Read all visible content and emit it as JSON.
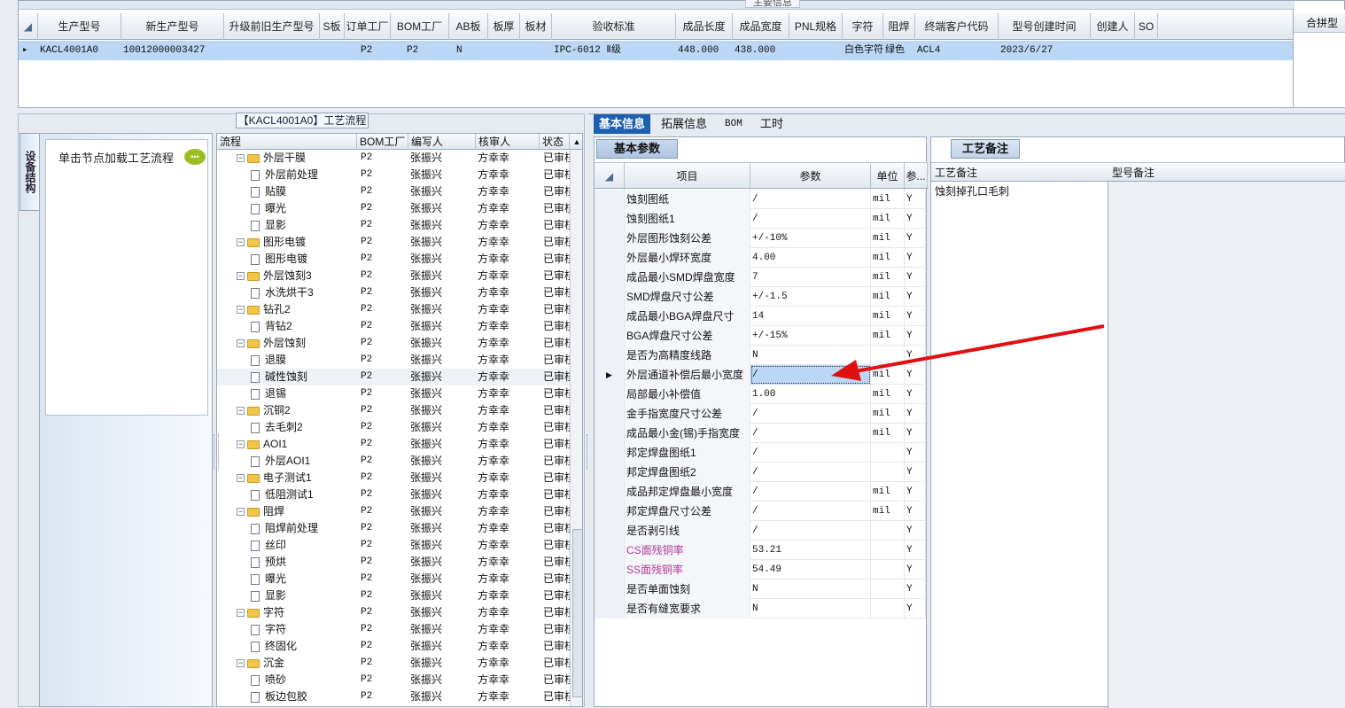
{
  "top": {
    "section_title": "主要信息",
    "columns": [
      "生产型号",
      "新生产型号",
      "升级前旧生产型号",
      "S板",
      "订单工厂",
      "BOM工厂",
      "AB板",
      "板厚",
      "板材",
      "验收标准",
      "成品长度",
      "成品宽度",
      "PNL规格",
      "字符",
      "阻焊",
      "终端客户代码",
      "型号创建时间",
      "创建人",
      "SO"
    ],
    "row": {
      "生产型号": "KACL4001A0",
      "新生产型号": "10012000003427",
      "订单工厂": "P2",
      "BOM工厂": "P2",
      "AB板": "N",
      "验收标准": "IPC-6012 Ⅱ级",
      "成品长度": "448.000",
      "成品宽度": "438.000",
      "字符": "白色字符",
      "阻焊": "绿色",
      "终端客户代码": "ACL4",
      "型号创建时间": "2023/6/27"
    },
    "side_column": "合拼型"
  },
  "left": {
    "process_title": "【KACL4001A0】工艺流程",
    "vertical_tab": "设备结构",
    "hint": "单击节点加载工艺流程"
  },
  "tree": {
    "headers": [
      "流程",
      "BOM工厂",
      "编写人",
      "核审人",
      "状态"
    ],
    "rows": [
      {
        "level": 0,
        "name": "外层干膜",
        "bom": "P2",
        "writer": "张振兴",
        "reviewer": "方幸幸",
        "status": "已审核"
      },
      {
        "level": 1,
        "name": "外层前处理",
        "bom": "P2",
        "writer": "张振兴",
        "reviewer": "方幸幸",
        "status": "已审核"
      },
      {
        "level": 1,
        "name": "贴膜",
        "bom": "P2",
        "writer": "张振兴",
        "reviewer": "方幸幸",
        "status": "已审核"
      },
      {
        "level": 1,
        "name": "曝光",
        "bom": "P2",
        "writer": "张振兴",
        "reviewer": "方幸幸",
        "status": "已审核"
      },
      {
        "level": 1,
        "name": "显影",
        "bom": "P2",
        "writer": "张振兴",
        "reviewer": "方幸幸",
        "status": "已审核"
      },
      {
        "level": 0,
        "name": "图形电镀",
        "bom": "P2",
        "writer": "张振兴",
        "reviewer": "方幸幸",
        "status": "已审核"
      },
      {
        "level": 1,
        "name": "图形电镀",
        "bom": "P2",
        "writer": "张振兴",
        "reviewer": "方幸幸",
        "status": "已审核"
      },
      {
        "level": 0,
        "name": "外层蚀刻3",
        "bom": "P2",
        "writer": "张振兴",
        "reviewer": "方幸幸",
        "status": "已审核"
      },
      {
        "level": 1,
        "name": "水洗烘干3",
        "bom": "P2",
        "writer": "张振兴",
        "reviewer": "方幸幸",
        "status": "已审核"
      },
      {
        "level": 0,
        "name": "钻孔2",
        "bom": "P2",
        "writer": "张振兴",
        "reviewer": "方幸幸",
        "status": "已审核"
      },
      {
        "level": 1,
        "name": "背钻2",
        "bom": "P2",
        "writer": "张振兴",
        "reviewer": "方幸幸",
        "status": "已审核"
      },
      {
        "level": 0,
        "name": "外层蚀刻",
        "bom": "P2",
        "writer": "张振兴",
        "reviewer": "方幸幸",
        "status": "已审核"
      },
      {
        "level": 1,
        "name": "退膜",
        "bom": "P2",
        "writer": "张振兴",
        "reviewer": "方幸幸",
        "status": "已审核"
      },
      {
        "level": 1,
        "name": "碱性蚀刻",
        "bom": "P2",
        "writer": "张振兴",
        "reviewer": "方幸幸",
        "status": "已审核",
        "selected": true
      },
      {
        "level": 1,
        "name": "退锡",
        "bom": "P2",
        "writer": "张振兴",
        "reviewer": "方幸幸",
        "status": "已审核"
      },
      {
        "level": 0,
        "name": "沉铜2",
        "bom": "P2",
        "writer": "张振兴",
        "reviewer": "方幸幸",
        "status": "已审核"
      },
      {
        "level": 1,
        "name": "去毛刺2",
        "bom": "P2",
        "writer": "张振兴",
        "reviewer": "方幸幸",
        "status": "已审核"
      },
      {
        "level": 0,
        "name": "AOI1",
        "bom": "P2",
        "writer": "张振兴",
        "reviewer": "方幸幸",
        "status": "已审核"
      },
      {
        "level": 1,
        "name": "外层AOI1",
        "bom": "P2",
        "writer": "张振兴",
        "reviewer": "方幸幸",
        "status": "已审核"
      },
      {
        "level": 0,
        "name": "电子测试1",
        "bom": "P2",
        "writer": "张振兴",
        "reviewer": "方幸幸",
        "status": "已审核"
      },
      {
        "level": 1,
        "name": "低阻测试1",
        "bom": "P2",
        "writer": "张振兴",
        "reviewer": "方幸幸",
        "status": "已审核"
      },
      {
        "level": 0,
        "name": "阻焊",
        "bom": "P2",
        "writer": "张振兴",
        "reviewer": "方幸幸",
        "status": "已审核"
      },
      {
        "level": 1,
        "name": "阻焊前处理",
        "bom": "P2",
        "writer": "张振兴",
        "reviewer": "方幸幸",
        "status": "已审核"
      },
      {
        "level": 1,
        "name": "丝印",
        "bom": "P2",
        "writer": "张振兴",
        "reviewer": "方幸幸",
        "status": "已审核"
      },
      {
        "level": 1,
        "name": "预烘",
        "bom": "P2",
        "writer": "张振兴",
        "reviewer": "方幸幸",
        "status": "已审核"
      },
      {
        "level": 1,
        "name": "曝光",
        "bom": "P2",
        "writer": "张振兴",
        "reviewer": "方幸幸",
        "status": "已审核"
      },
      {
        "level": 1,
        "name": "显影",
        "bom": "P2",
        "writer": "张振兴",
        "reviewer": "方幸幸",
        "status": "已审核"
      },
      {
        "level": 0,
        "name": "字符",
        "bom": "P2",
        "writer": "张振兴",
        "reviewer": "方幸幸",
        "status": "已审核"
      },
      {
        "level": 1,
        "name": "字符",
        "bom": "P2",
        "writer": "张振兴",
        "reviewer": "方幸幸",
        "status": "已审核"
      },
      {
        "level": 1,
        "name": "终固化",
        "bom": "P2",
        "writer": "张振兴",
        "reviewer": "方幸幸",
        "status": "已审核"
      },
      {
        "level": 0,
        "name": "沉金",
        "bom": "P2",
        "writer": "张振兴",
        "reviewer": "方幸幸",
        "status": "已审核"
      },
      {
        "level": 1,
        "name": "喷砂",
        "bom": "P2",
        "writer": "张振兴",
        "reviewer": "方幸幸",
        "status": "已审核"
      },
      {
        "level": 1,
        "name": "板边包胶",
        "bom": "P2",
        "writer": "张振兴",
        "reviewer": "方幸幸",
        "status": "已审核"
      }
    ]
  },
  "right_tabs": [
    "基本信息",
    "拓展信息",
    "BOM",
    "工时"
  ],
  "basic": {
    "tab": "基本参数",
    "headers": [
      "项目",
      "参数",
      "单位",
      "参..."
    ],
    "rows": [
      {
        "name": "蚀刻图纸",
        "value": "/",
        "unit": "mil",
        "flag": "Y"
      },
      {
        "name": "蚀刻图纸1",
        "value": "/",
        "unit": "mil",
        "flag": "Y"
      },
      {
        "name": "外层图形蚀刻公差",
        "value": "+/-10%",
        "unit": "mil",
        "flag": "Y"
      },
      {
        "name": "外层最小焊环宽度",
        "value": "4.00",
        "unit": "mil",
        "flag": "Y"
      },
      {
        "name": "成品最小SMD焊盘宽度",
        "value": "7",
        "unit": "mil",
        "flag": "Y"
      },
      {
        "name": "SMD焊盘尺寸公差",
        "value": "+/-1.5",
        "unit": "mil",
        "flag": "Y"
      },
      {
        "name": "成品最小BGA焊盘尺寸",
        "value": "14",
        "unit": "mil",
        "flag": "Y"
      },
      {
        "name": "BGA焊盘尺寸公差",
        "value": "+/-15%",
        "unit": "mil",
        "flag": "Y"
      },
      {
        "name": "是否为高精度线路",
        "value": "N",
        "unit": "",
        "flag": "Y"
      },
      {
        "name": "外层通道补偿后最小宽度",
        "value": "/",
        "unit": "mil",
        "flag": "Y",
        "selected": true
      },
      {
        "name": "局部最小补偿值",
        "value": "1.00",
        "unit": "mil",
        "flag": "Y"
      },
      {
        "name": "金手指宽度尺寸公差",
        "value": "/",
        "unit": "mil",
        "flag": "Y"
      },
      {
        "name": "成品最小金(锡)手指宽度",
        "value": "/",
        "unit": "mil",
        "flag": "Y"
      },
      {
        "name": "邦定焊盘图纸1",
        "value": "/",
        "unit": "",
        "flag": "Y"
      },
      {
        "name": "邦定焊盘图纸2",
        "value": "/",
        "unit": "",
        "flag": "Y"
      },
      {
        "name": "成品邦定焊盘最小宽度",
        "value": "/",
        "unit": "mil",
        "flag": "Y"
      },
      {
        "name": "邦定焊盘尺寸公差",
        "value": "/",
        "unit": "mil",
        "flag": "Y"
      },
      {
        "name": "是否剥引线",
        "value": "/",
        "unit": "",
        "flag": "Y"
      },
      {
        "name": "CS面残铜率",
        "value": "53.21",
        "unit": "",
        "flag": "Y",
        "purple": true
      },
      {
        "name": "SS面残铜率",
        "value": "54.49",
        "unit": "",
        "flag": "Y",
        "purple": true
      },
      {
        "name": "是否单面蚀刻",
        "value": "N",
        "unit": "",
        "flag": "Y"
      },
      {
        "name": "是否有缝宽要求",
        "value": "N",
        "unit": "",
        "flag": "Y"
      }
    ]
  },
  "craft": {
    "tab": "工艺备注",
    "col1": "工艺备注",
    "col2": "型号备注",
    "note": "蚀刻掉孔口毛刺"
  },
  "colors": {
    "selected_row": "#bcd7f5",
    "purple_text": "#b03a9a",
    "arrow": "#e01010",
    "tab_active": "#1c5fb0"
  }
}
